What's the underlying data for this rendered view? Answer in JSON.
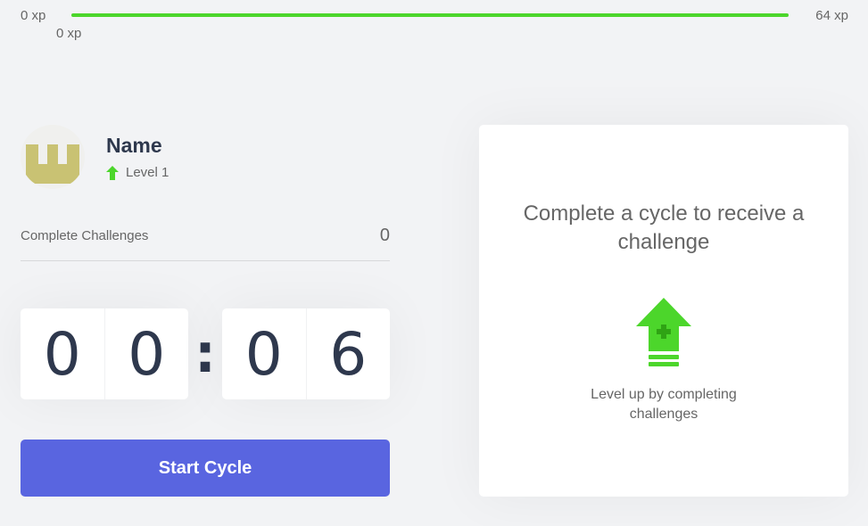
{
  "xp": {
    "min_label": "0 xp",
    "max_label": "64 xp",
    "current_label": "0 xp",
    "progress_fraction": 1.0,
    "bar_color": "#4cd62b"
  },
  "profile": {
    "name": "Name",
    "level_label": "Level 1",
    "level_icon": "level-up-arrow-icon",
    "avatar_icon": "avatar-logo"
  },
  "stats": {
    "completed_label": "Complete Challenges",
    "completed_value": "0"
  },
  "countdown": {
    "minute_tens": "0",
    "minute_ones": "0",
    "separator": ":",
    "second_tens": "0",
    "second_ones": "6"
  },
  "actions": {
    "start_label": "Start Cycle",
    "button_color": "#5965e0"
  },
  "challenge": {
    "title": "Complete a cycle to receive a challenge",
    "icon": "level-up-icon",
    "description": "Level up by completing challenges"
  }
}
